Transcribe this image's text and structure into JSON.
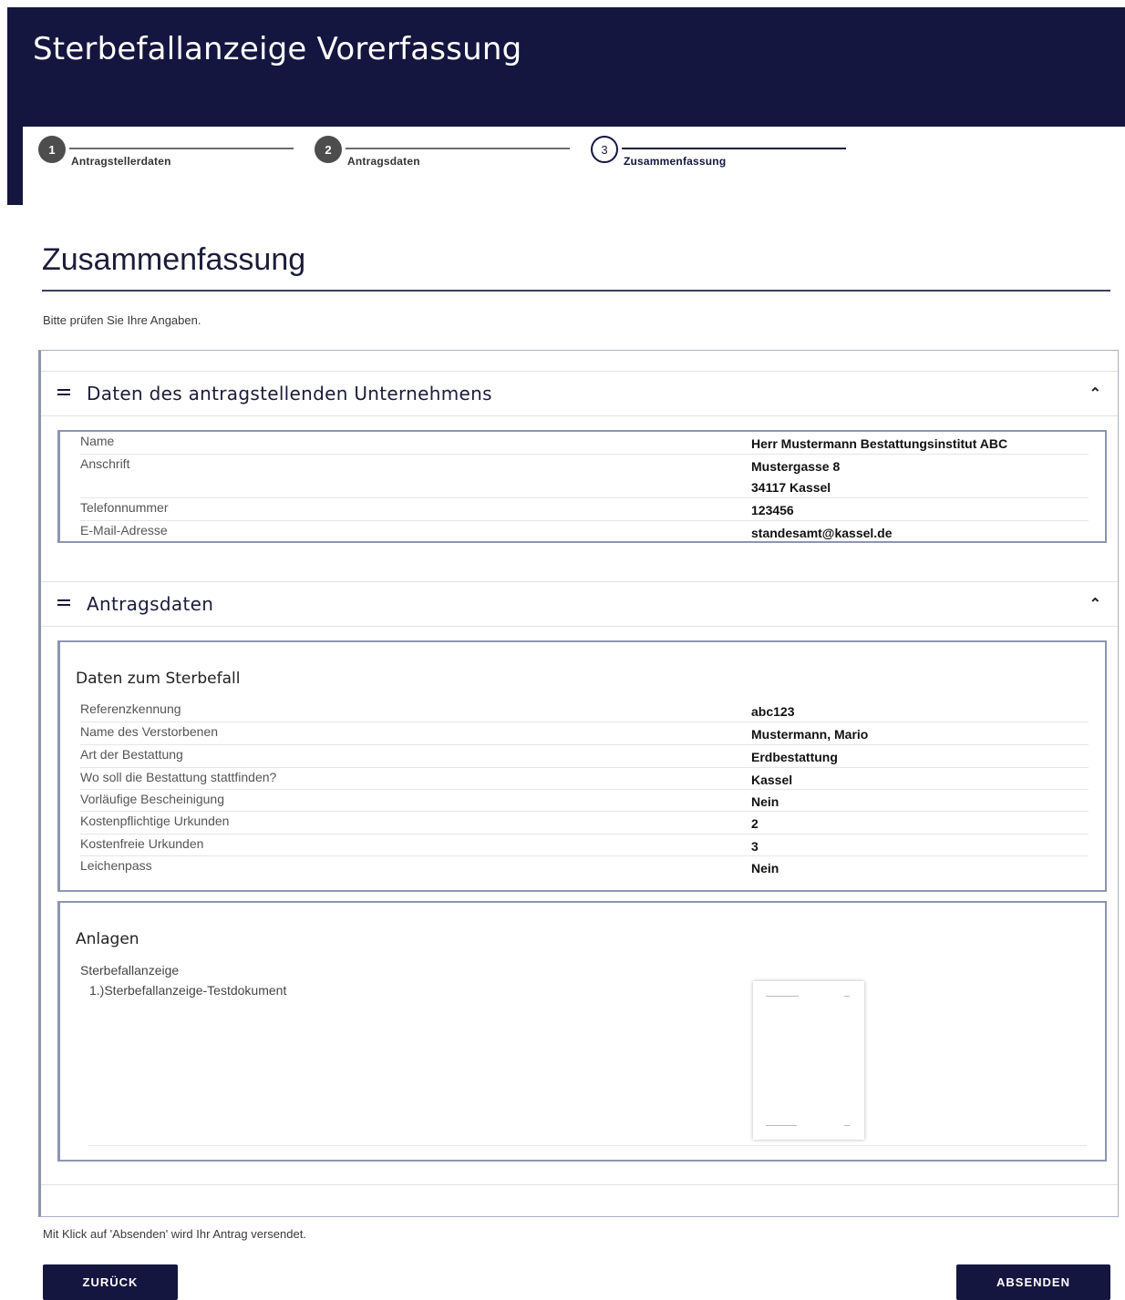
{
  "header": {
    "title": "Sterbefallanzeige Vorerfassung"
  },
  "stepper": {
    "steps": [
      {
        "number": "1",
        "label": "Antragstellerdaten"
      },
      {
        "number": "2",
        "label": "Antragsdaten"
      },
      {
        "number": "3",
        "label": "Zusammenfassung"
      }
    ]
  },
  "page": {
    "title": "Zusammenfassung",
    "hint": "Bitte prüfen Sie Ihre Angaben."
  },
  "company": {
    "title": "Daten des antragstellenden Unternehmens",
    "rows": [
      {
        "label": "Name",
        "value": "Herr Mustermann Bestattungsinstitut ABC"
      },
      {
        "label": "Anschrift",
        "value": "Mustergasse 8",
        "value2": "34117 Kassel"
      },
      {
        "label": "Telefonnummer",
        "value": "123456"
      },
      {
        "label": "E-Mail-Adresse",
        "value": "standesamt@kassel.de"
      }
    ]
  },
  "application": {
    "title": "Antragsdaten",
    "death_case": {
      "heading": "Daten zum Sterbefall",
      "rows": [
        {
          "label": "Referenzkennung",
          "value": "abc123"
        },
        {
          "label": "Name des Verstorbenen",
          "value": "Mustermann, Mario"
        },
        {
          "label": "Art der Bestattung",
          "value": "Erdbestattung"
        },
        {
          "label": "Wo soll die Bestattung stattfinden?",
          "value": "Kassel"
        },
        {
          "label": "Vorläufige Bescheinigung",
          "value": "Nein"
        },
        {
          "label": "Kostenpflichtige Urkunden",
          "value": "2"
        },
        {
          "label": "Kostenfreie Urkunden",
          "value": "3"
        },
        {
          "label": "Leichenpass",
          "value": "Nein"
        }
      ]
    },
    "attachments": {
      "heading": "Anlagen",
      "category": "Sterbefallanzeige",
      "document": "1.)Sterbefallanzeige-Testdokument"
    }
  },
  "footer": {
    "note": "Mit Klick auf 'Absenden' wird Ihr Antrag versendet.",
    "back_label": "ZURÜCK",
    "send_label": "ABSENDEN"
  }
}
